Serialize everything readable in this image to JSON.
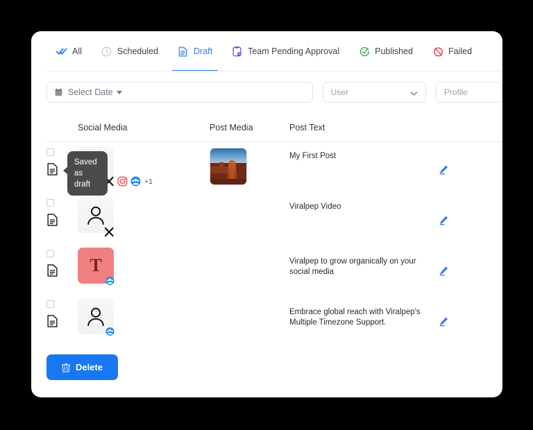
{
  "tabs": [
    {
      "label": "All",
      "icon": "double-check-icon",
      "active": false
    },
    {
      "label": "Scheduled",
      "icon": "clock-icon",
      "active": false
    },
    {
      "label": "Draft",
      "icon": "document-icon",
      "active": true
    },
    {
      "label": "Team Pending Approval",
      "icon": "clipboard-icon",
      "active": false
    },
    {
      "label": "Published",
      "icon": "check-circle-icon",
      "active": false
    },
    {
      "label": "Failed",
      "icon": "blocked-icon",
      "active": false
    }
  ],
  "filters": {
    "date": {
      "label": "Select Date",
      "icon": "calendar-icon"
    },
    "user": {
      "value": "User",
      "icon": "chevron-down-icon"
    },
    "profile": {
      "value": "Profile"
    }
  },
  "table": {
    "headers": {
      "checkbox": "",
      "social_media": "Social Media",
      "post_media": "Post Media",
      "post_text": "Post Text",
      "actions": ""
    },
    "rows": [
      {
        "status_icon": "draft-document-icon",
        "tooltip": "Saved as draft",
        "avatar_type": "ghost",
        "avatar_letter": "",
        "networks": [
          "x-icon",
          "instagram-icon",
          "facebook-icon"
        ],
        "extra_networks": "+1",
        "has_media": true,
        "media_alt": "desert-butte-photo",
        "post_text": "My First Post",
        "edit_icon": "pencil-icon"
      },
      {
        "status_icon": "draft-document-icon",
        "tooltip": "",
        "avatar_type": "ghost",
        "avatar_letter": "",
        "networks": [
          "x-icon"
        ],
        "extra_networks": "",
        "has_media": false,
        "media_alt": "",
        "post_text": "Viralpep Video",
        "edit_icon": "pencil-icon"
      },
      {
        "status_icon": "draft-document-icon",
        "tooltip": "",
        "avatar_type": "letter",
        "avatar_letter": "T",
        "networks": [
          "facebook-icon"
        ],
        "extra_networks": "",
        "has_media": false,
        "media_alt": "",
        "post_text": "Viralpep to grow organically on your social media",
        "edit_icon": "pencil-icon"
      },
      {
        "status_icon": "draft-document-icon",
        "tooltip": "",
        "avatar_type": "ghost",
        "avatar_letter": "",
        "networks": [
          "facebook-icon"
        ],
        "extra_networks": "",
        "has_media": false,
        "media_alt": "",
        "post_text": "Embrace global reach with Viralpep's Multiple Timezone Support.",
        "edit_icon": "pencil-icon"
      }
    ]
  },
  "footer": {
    "delete_label": "Delete",
    "delete_icon": "trash-icon"
  },
  "colors": {
    "accent": "#2b7cf0",
    "delete_button": "#1877f2",
    "tooltip_bg": "#4a4a4a",
    "avatar_letter_bg": "#f08080",
    "published_green": "#3aa757",
    "failed_red": "#e8414a",
    "approval_purple": "#6f4fd8"
  }
}
